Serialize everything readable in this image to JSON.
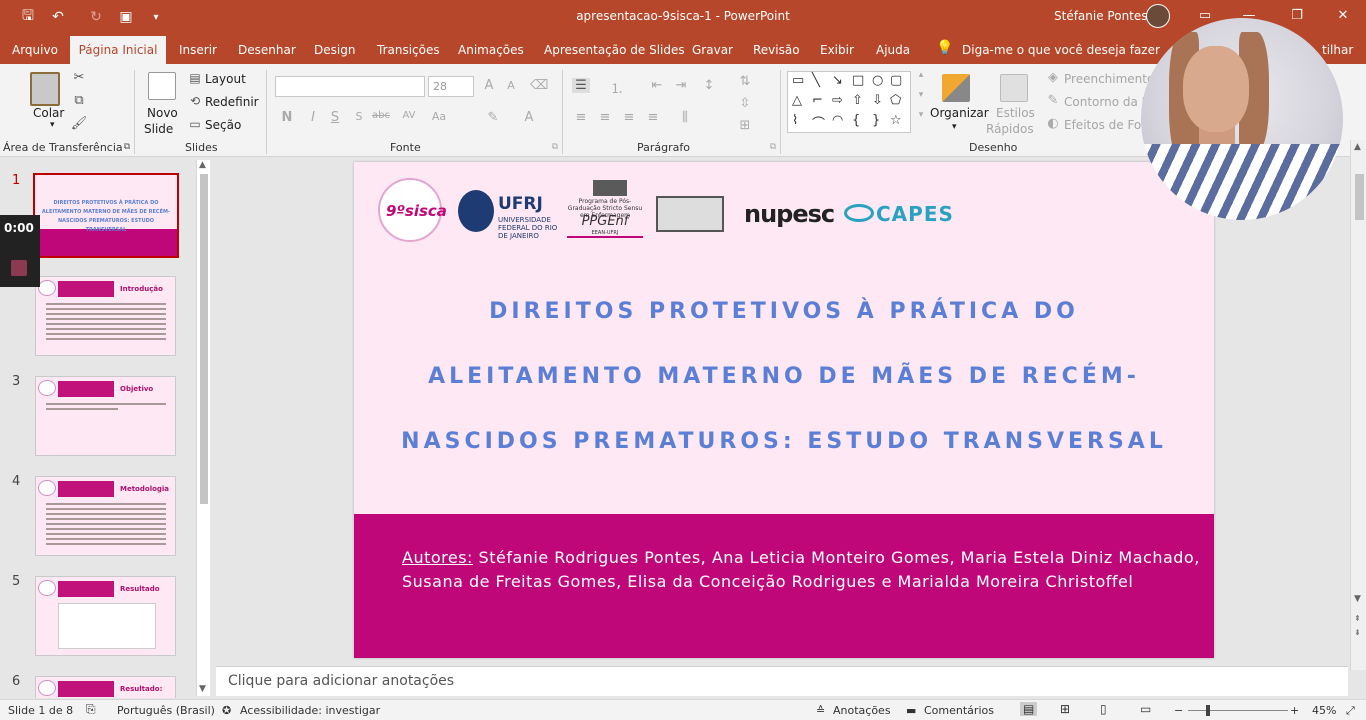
{
  "window": {
    "doc_title": "apresentacao-9sisca-1  -  PowerPoint",
    "user_name": "Stéfanie Pontes"
  },
  "menu": {
    "file": "Arquivo",
    "tabs": [
      "Página Inicial",
      "Inserir",
      "Desenhar",
      "Design",
      "Transições",
      "Animações",
      "Apresentação de Slides",
      "Gravar",
      "Revisão",
      "Exibir",
      "Ajuda"
    ],
    "tell_me": "Diga-me o que você deseja fazer",
    "share_partial": "tilhar"
  },
  "ribbon": {
    "clipboard": {
      "label": "Área de Transferência",
      "paste": "Colar"
    },
    "slides": {
      "label": "Slides",
      "new_slide_1": "Novo",
      "new_slide_2": "Slide",
      "layout": "Layout",
      "reset": "Redefinir",
      "section": "Seção"
    },
    "font": {
      "label": "Fonte",
      "font_name": "",
      "font_size": "28"
    },
    "paragraph": {
      "label": "Parágrafo"
    },
    "drawing": {
      "label": "Desenho",
      "arrange": "Organizar",
      "quick_styles_1": "Estilos",
      "quick_styles_2": "Rápidos",
      "fill": "Preenchimento",
      "outline": "Contorno da Fo",
      "effects": "Efeitos de Form"
    }
  },
  "timer": "0:00",
  "thumbnails": [
    {
      "num": "1",
      "title": "DIREITOS PROTETIVOS À PRÁTICA DO ALEITAMENTO MATERNO DE MÃES DE RECÉM-NASCIDOS PREMATUROS: ESTUDO TRANSVERSAL"
    },
    {
      "num": "",
      "title": "Introdução"
    },
    {
      "num": "3",
      "title": "Objetivo"
    },
    {
      "num": "4",
      "title": "Metodologia"
    },
    {
      "num": "5",
      "title": "Resultado"
    },
    {
      "num": "6",
      "title": "Resultado:"
    }
  ],
  "slide": {
    "logos": {
      "sisca": "9ºsisca",
      "ufrj": "UFRJ",
      "ufrj_sub": "UNIVERSIDADE FEDERAL DO RIO DE JANEIRO",
      "ppg_small": "Programa de Pós-Graduação Stricto Sensu em Enfermagem",
      "ppg": "PPGEnf",
      "ppg_sub": "EEAN-UFRJ",
      "nupesc": "nupesc",
      "capes": "CAPES"
    },
    "title_lines": [
      "DIREITOS PROTETIVOS À PRÁTICA DO",
      "ALEITAMENTO MATERNO DE MÃES DE RECÉM-",
      "NASCIDOS PREMATUROS: ESTUDO TRANSVERSAL"
    ],
    "authors_label": "Autores:",
    "authors": " Stéfanie Rodrigues Pontes, Ana Leticia Monteiro Gomes, Maria Estela Diniz Machado, Susana de Freitas Gomes, Elisa da Conceição Rodrigues e Marialda Moreira Christoffel"
  },
  "notes_placeholder": "Clique para adicionar anotações",
  "status": {
    "slide_count": "Slide 1 de 8",
    "language": "Português (Brasil)",
    "accessibility": "Acessibilidade: investigar",
    "notes": "Anotações",
    "comments": "Comentários",
    "zoom": "45%"
  },
  "colors": {
    "accent": "#b7472a",
    "slide_bg": "#fde8f3",
    "band": "#c0077a",
    "title": "#5b7fd6"
  }
}
